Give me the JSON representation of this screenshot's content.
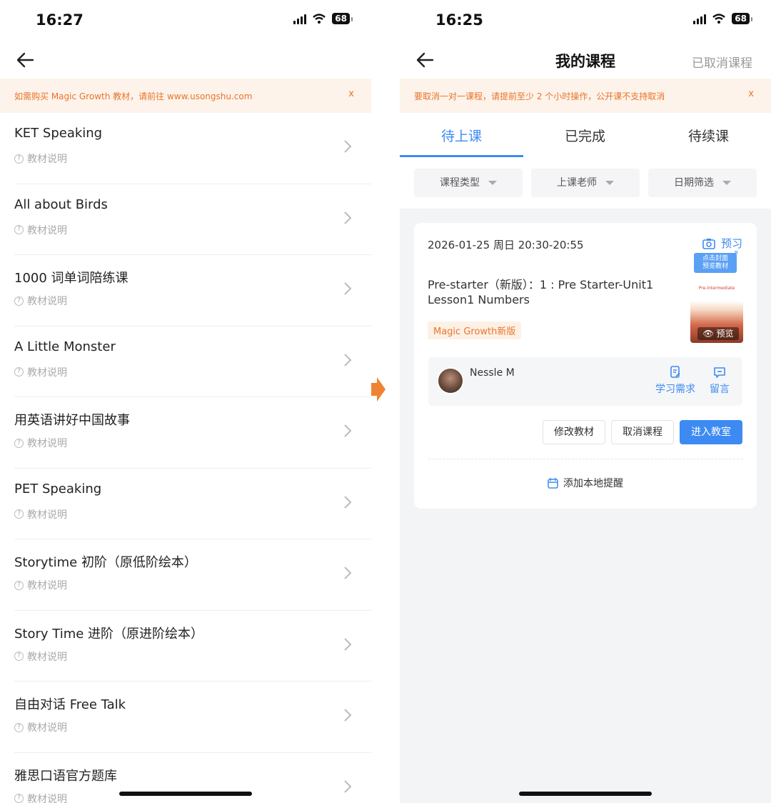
{
  "left": {
    "status": {
      "time": "16:27",
      "battery": "68"
    },
    "notice": {
      "text": "如需购买 Magic Growth 教材，请前往 www.usongshu.com",
      "close": "x"
    },
    "items": [
      {
        "title": "KET Speaking",
        "sub": "教材说明"
      },
      {
        "title": "All about Birds",
        "sub": "教材说明"
      },
      {
        "title": "1000 词单词陪练课",
        "sub": "教材说明"
      },
      {
        "title": "A Little Monster",
        "sub": "教材说明"
      },
      {
        "title": "用英语讲好中国故事",
        "sub": "教材说明"
      },
      {
        "title": "PET Speaking",
        "sub": "教材说明"
      },
      {
        "title": "Storytime 初阶（原低阶绘本）",
        "sub": "教材说明"
      },
      {
        "title": "Story Time 进阶（原进阶绘本）",
        "sub": "教材说明"
      },
      {
        "title": "自由对话 Free Talk",
        "sub": "教材说明"
      },
      {
        "title": "雅思口语官方题库",
        "sub": "教材说明"
      }
    ]
  },
  "right": {
    "status": {
      "time": "16:25",
      "battery": "68"
    },
    "nav": {
      "title": "我的课程",
      "right": "已取消课程"
    },
    "notice": {
      "text": "要取消一对一课程，请提前至少 2 个小时操作，公开课不支持取消",
      "close": "x"
    },
    "tabs": [
      "待上课",
      "已完成",
      "待续课"
    ],
    "filters": [
      "课程类型",
      "上课老师",
      "日期筛选"
    ],
    "card": {
      "datetime": "2026-01-25 周日 20:30-20:55",
      "preview": "预习",
      "tip": [
        "点击封面",
        "预览教材"
      ],
      "tip_close": "×",
      "course_line1": "Pre-starter（新版）：1 : Pre Starter-Unit1",
      "course_line2": "Lesson1 Numbers",
      "tag": "Magic Growth新版",
      "cover_label": "Pre-Intermediate",
      "cover_button": "预览",
      "teacher": "Nessle M",
      "action_study": "学习需求",
      "action_message": "留言",
      "btn_modify": "修改教材",
      "btn_cancel": "取消课程",
      "btn_enter": "进入教室",
      "remind": "添加本地提醒"
    }
  }
}
